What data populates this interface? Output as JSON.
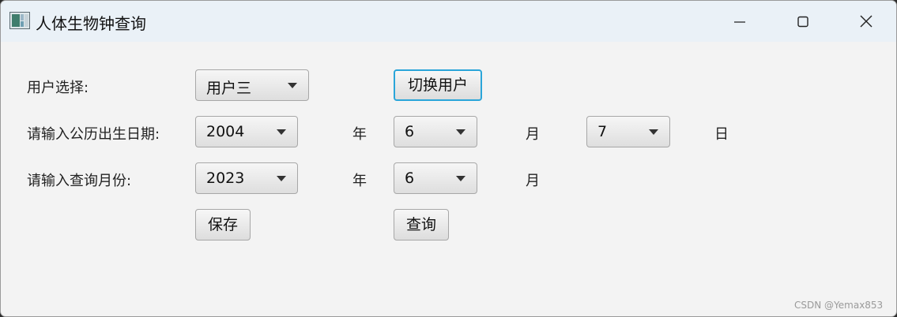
{
  "window": {
    "title": "人体生物钟查询",
    "icons": {
      "app": "app-icon",
      "minimize": "minimize-icon",
      "maximize": "maximize-icon",
      "close": "close-icon"
    }
  },
  "user_row": {
    "label": "用户选择:",
    "selected": "用户三",
    "switch_label": "切换用户"
  },
  "birth_row": {
    "label": "请输入公历出生日期:",
    "year": "2004",
    "year_unit": "年",
    "month": "6",
    "month_unit": "月",
    "day": "7",
    "day_unit": "日"
  },
  "query_row": {
    "label": "请输入查询月份:",
    "year": "2023",
    "year_unit": "年",
    "month": "6",
    "month_unit": "月"
  },
  "actions": {
    "save_label": "保存",
    "query_label": "查询"
  },
  "watermark": "CSDN @Yemax853",
  "colors": {
    "focus_border": "#2aa5d9",
    "background": "#f3f3f3",
    "titlebar": "#eaf1f7"
  }
}
